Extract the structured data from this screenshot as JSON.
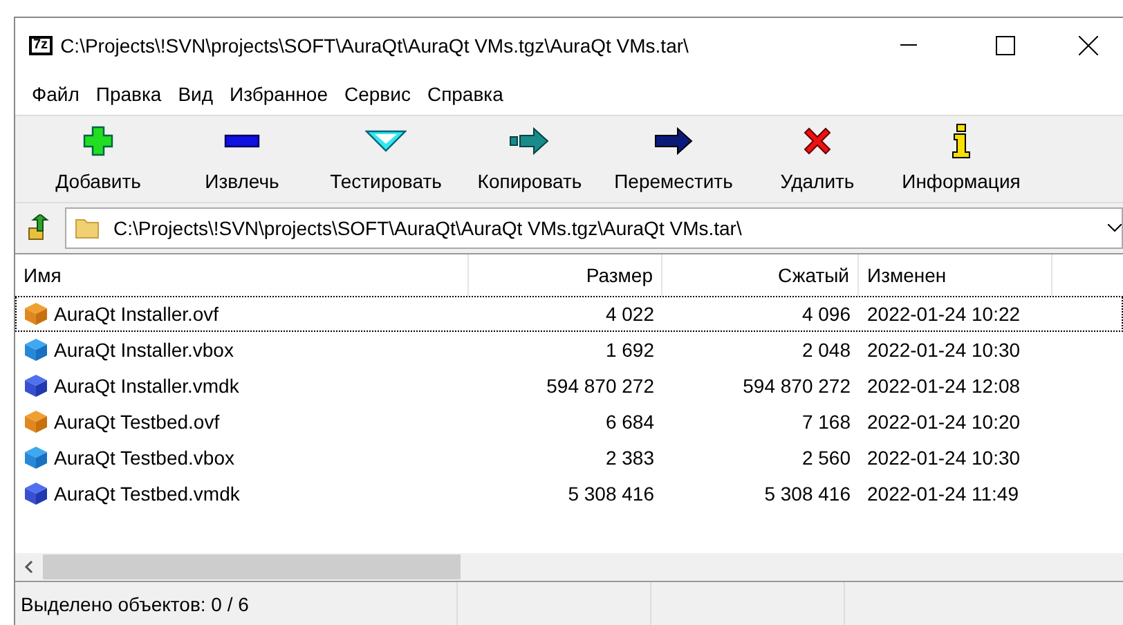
{
  "window": {
    "title": "C:\\Projects\\!SVN\\projects\\SOFT\\AuraQt\\AuraQt VMs.tgz\\AuraQt VMs.tar\\",
    "app_icon": "7z"
  },
  "menu": [
    "Файл",
    "Правка",
    "Вид",
    "Избранное",
    "Сервис",
    "Справка"
  ],
  "toolbar": [
    {
      "kind": "add",
      "label": "Добавить"
    },
    {
      "kind": "extract",
      "label": "Извлечь"
    },
    {
      "kind": "test",
      "label": "Тестировать"
    },
    {
      "kind": "copy",
      "label": "Копировать"
    },
    {
      "kind": "move",
      "label": "Переместить"
    },
    {
      "kind": "delete",
      "label": "Удалить"
    },
    {
      "kind": "info",
      "label": "Информация"
    }
  ],
  "address": {
    "value": "C:\\Projects\\!SVN\\projects\\SOFT\\AuraQt\\AuraQt VMs.tgz\\AuraQt VMs.tar\\"
  },
  "table": {
    "columns": [
      {
        "label": "Имя",
        "kind": "text"
      },
      {
        "label": "Размер",
        "kind": "number"
      },
      {
        "label": "Сжатый",
        "kind": "number"
      },
      {
        "label": "Изменен",
        "kind": "text"
      }
    ],
    "rows": [
      {
        "kind": "ovf",
        "focused": true,
        "cells": [
          "AuraQt Installer.ovf",
          "4 022",
          "4 096",
          "2022-01-24 10:22"
        ]
      },
      {
        "kind": "vbox",
        "focused": false,
        "cells": [
          "AuraQt Installer.vbox",
          "1 692",
          "2 048",
          "2022-01-24 10:30"
        ]
      },
      {
        "kind": "vmdk",
        "focused": false,
        "cells": [
          "AuraQt Installer.vmdk",
          "594 870 272",
          "594 870 272",
          "2022-01-24 12:08"
        ]
      },
      {
        "kind": "ovf",
        "focused": false,
        "cells": [
          "AuraQt Testbed.ovf",
          "6 684",
          "7 168",
          "2022-01-24 10:20"
        ]
      },
      {
        "kind": "vbox",
        "focused": false,
        "cells": [
          "AuraQt Testbed.vbox",
          "2 383",
          "2 560",
          "2022-01-24 10:30"
        ]
      },
      {
        "kind": "vmdk",
        "focused": false,
        "cells": [
          "AuraQt Testbed.vmdk",
          "5 308 416",
          "5 308 416",
          "2022-01-24 11:49"
        ]
      }
    ]
  },
  "status_bar": {
    "text": "Выделено объектов: 0 / 6"
  }
}
